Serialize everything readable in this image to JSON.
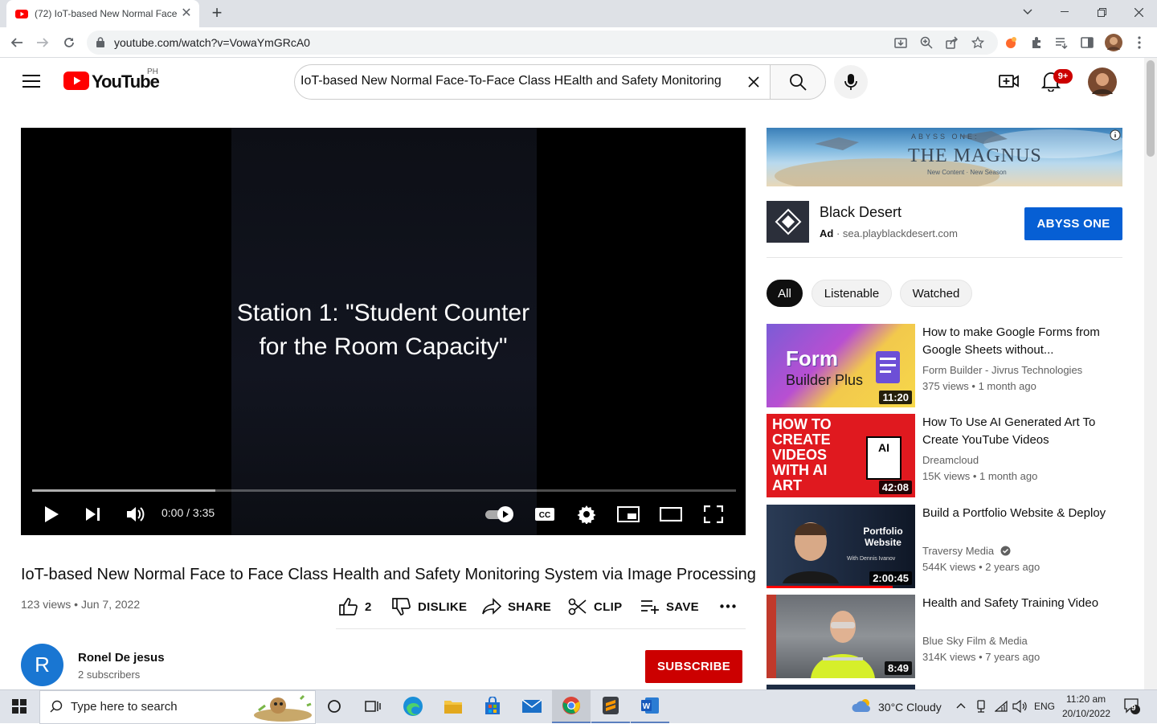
{
  "browser": {
    "tab_title": "(72) IoT-based New Normal Face",
    "url": "youtube.com/watch?v=VowaYmGRcA0"
  },
  "youtube": {
    "logo_text": "YouTube",
    "country_code": "PH",
    "search_value": "IoT-based New Normal Face-To-Face Class HEalth and Safety Monitoring",
    "notifications_badge": "9+"
  },
  "player": {
    "caption_line1": "Station 1: \"Student Counter",
    "caption_line2": "for the Room Capacity\"",
    "timecode": "0:00 / 3:35",
    "loaded_fraction": 0.26
  },
  "video": {
    "title": "IoT-based New Normal Face to Face Class Health and Safety Monitoring System via Image Processing",
    "views": "123 views",
    "date": "Jun 7, 2022",
    "like_count": "2",
    "dislike_label": "DISLIKE",
    "share_label": "SHARE",
    "clip_label": "CLIP",
    "save_label": "SAVE"
  },
  "channel": {
    "avatar_letter": "R",
    "name": "Ronel De jesus",
    "subscribers": "2 subscribers",
    "subscribe_label": "SUBSCRIBE"
  },
  "ad": {
    "banner_small": "ABYSS ONE:",
    "banner_title": "THE MAGNUS",
    "banner_sub": "New Content · New Season",
    "brand": "Black Desert",
    "ad_label": "Ad",
    "domain": "sea.playblackdesert.com",
    "cta": "ABYSS ONE"
  },
  "chips": [
    "All",
    "Listenable",
    "Watched"
  ],
  "recommendations": [
    {
      "title": "How to make Google Forms from Google Sheets without...",
      "channel": "Form Builder - Jivrus Technologies",
      "meta": "375 views • 1 month ago",
      "duration": "11:20",
      "thumb_text1": "Form",
      "thumb_text2": "Builder Plus"
    },
    {
      "title": "How To Use AI Generated Art To Create YouTube Videos",
      "channel": "Dreamcloud",
      "meta": "15K views • 1 month ago",
      "duration": "42:08",
      "thumb_text1": "HOW TO CREATE VIDEOS WITH AI ART",
      "thumb_text2": "AI"
    },
    {
      "title": "Build a Portfolio Website & Deploy",
      "channel": "Traversy Media",
      "meta": "544K views • 2 years ago",
      "duration": "2:00:45",
      "thumb_text1": "Portfolio Website",
      "thumb_text2": "With Dennis Ivanov"
    },
    {
      "title": "Health and Safety Training Video",
      "channel": "Blue Sky Film & Media",
      "meta": "314K views • 7 years ago",
      "duration": "8:49",
      "thumb_text1": "",
      "thumb_text2": ""
    }
  ],
  "taskbar": {
    "search_placeholder": "Type here to search",
    "weather": "30°C  Cloudy",
    "language": "ENG",
    "time": "11:20 am",
    "date": "20/10/2022",
    "notification_count": "9"
  },
  "colors": {
    "youtube_red": "#ff0000",
    "subscribe_red": "#cc0000",
    "ad_blue": "#065fd4"
  }
}
